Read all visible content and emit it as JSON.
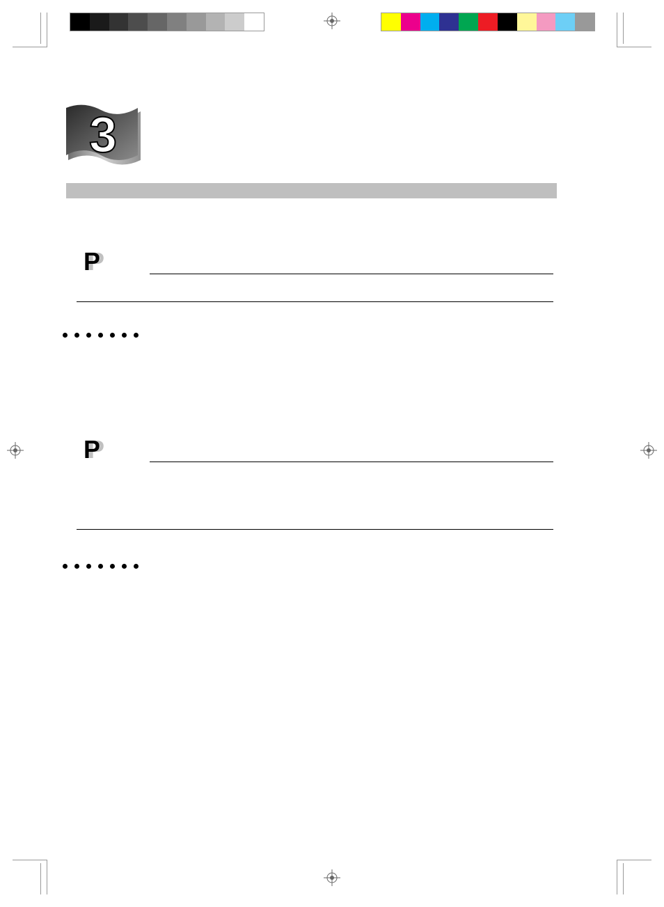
{
  "chapter_number": "3",
  "grayscale_swatches": [
    "#000000",
    "#1a1a1a",
    "#333333",
    "#4d4d4d",
    "#666666",
    "#808080",
    "#999999",
    "#b3b3b3",
    "#cccccc",
    "#ffffff"
  ],
  "color_swatches": [
    "#ffff00",
    "#ec008c",
    "#00aeef",
    "#2e3192",
    "#00a651",
    "#ed1c24",
    "#000000",
    "#fff799",
    "#f49ac1",
    "#6dcff6",
    "#999999"
  ],
  "dot_count": 7,
  "section_count": 2
}
